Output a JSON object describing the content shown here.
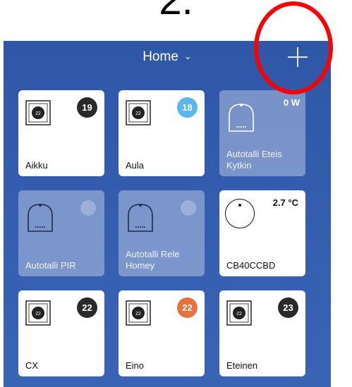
{
  "step_label": "2.",
  "header": {
    "title": "Home",
    "chevron": "⌄",
    "add_icon": "plus-icon"
  },
  "colors": {
    "background": "#3460af",
    "annotation": "#ff0000",
    "badge_dark": "#2a2a2a",
    "badge_blue": "#5bb8ea",
    "badge_orange": "#e8703d"
  },
  "devices": [
    {
      "name": "Aikku",
      "value": "19",
      "kind": "thermostat",
      "badge_color": "#2a2a2a"
    },
    {
      "name": "Aula",
      "value": "18",
      "kind": "thermostat",
      "badge_color": "#5bb8ea"
    },
    {
      "name": "Autotalli Eteis Kytkin",
      "value": "0 W",
      "kind": "switch-dim"
    },
    {
      "name": "Autotalli PIR",
      "value": "",
      "kind": "sensor-dim"
    },
    {
      "name": "Autotalli Rele Homey",
      "value": "",
      "kind": "sensor-dim"
    },
    {
      "name": "CB40CCBD",
      "value": "2.7 °C",
      "kind": "dial"
    },
    {
      "name": "CX",
      "value": "22",
      "kind": "thermostat",
      "badge_color": "#2a2a2a"
    },
    {
      "name": "Eino",
      "value": "22",
      "kind": "thermostat",
      "badge_color": "#e8703d"
    },
    {
      "name": "Eteinen",
      "value": "23",
      "kind": "thermostat",
      "badge_color": "#2a2a2a"
    }
  ]
}
